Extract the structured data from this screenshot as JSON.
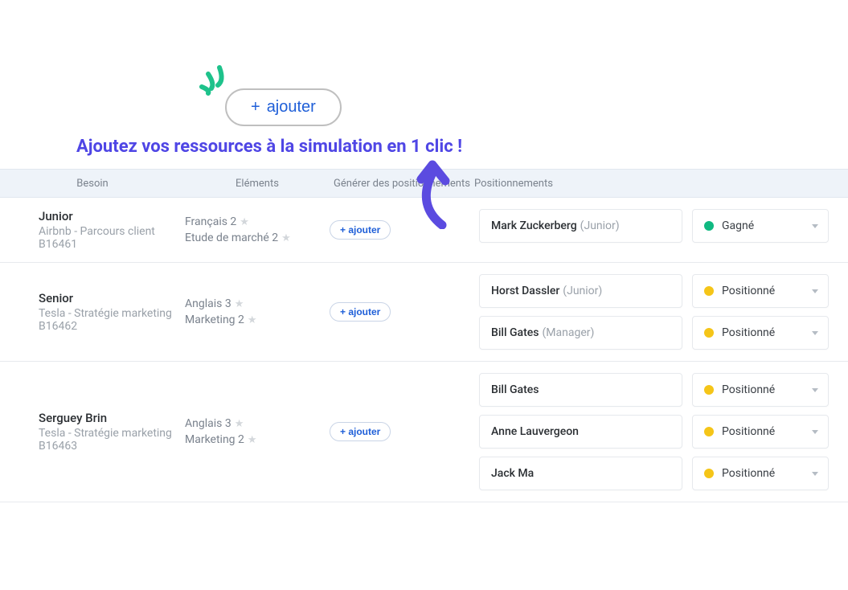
{
  "hero": {
    "add_button_label": "ajouter",
    "plus": "+",
    "headline": "Ajoutez vos ressources à la simulation en 1 clic !"
  },
  "columns": {
    "besoin": "Besoin",
    "elements": "Eléments",
    "generer": "Générer des positionnements",
    "positionnements": "Positionnements"
  },
  "add_small_label": "+ ajouter",
  "status": {
    "gagne": "Gagné",
    "positionne": "Positionné"
  },
  "rows": [
    {
      "need_title": "Junior",
      "need_sub": "Airbnb - Parcours client",
      "need_code": "B16461",
      "elements": [
        {
          "label": "Français 2"
        },
        {
          "label": "Etude de marché 2"
        }
      ],
      "positions": [
        {
          "name": "Mark Zuckerberg",
          "role": "(Junior)",
          "status": "gagne"
        }
      ]
    },
    {
      "need_title": "Senior",
      "need_sub": "Tesla - Stratégie marketing",
      "need_code": "B16462",
      "elements": [
        {
          "label": "Anglais 3"
        },
        {
          "label": "Marketing 2"
        }
      ],
      "positions": [
        {
          "name": "Horst Dassler",
          "role": "(Junior)",
          "status": "positionne"
        },
        {
          "name": "Bill Gates",
          "role": "(Manager)",
          "status": "positionne"
        }
      ]
    },
    {
      "need_title": "Serguey Brin",
      "need_sub": "Tesla - Stratégie marketing",
      "need_code": "B16463",
      "elements": [
        {
          "label": "Anglais 3"
        },
        {
          "label": "Marketing 2"
        }
      ],
      "positions": [
        {
          "name": "Bill Gates",
          "role": "",
          "status": "positionne"
        },
        {
          "name": "Anne Lauvergeon",
          "role": "",
          "status": "positionne"
        },
        {
          "name": "Jack Ma",
          "role": "",
          "status": "positionne"
        }
      ]
    }
  ]
}
